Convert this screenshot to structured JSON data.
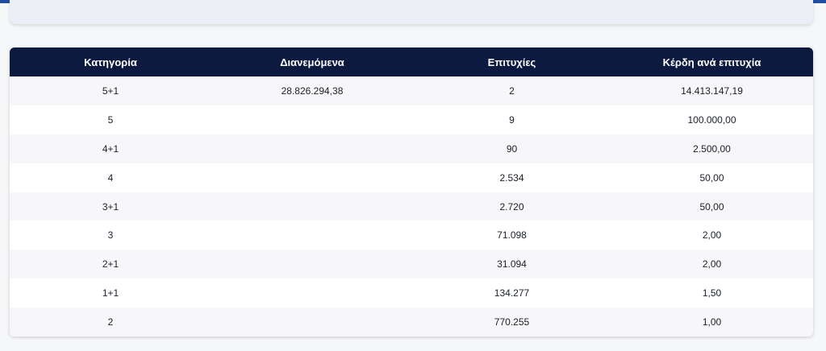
{
  "top_card": {
    "clipped_text": "' '' ' '"
  },
  "table": {
    "headers": [
      "Κατηγορία",
      "Διανεμόμενα",
      "Επιτυχίες",
      "Κέρδη ανά επιτυχία"
    ],
    "rows": [
      [
        "5+1",
        "28.826.294,38",
        "2",
        "14.413.147,19"
      ],
      [
        "5",
        "",
        "9",
        "100.000,00"
      ],
      [
        "4+1",
        "",
        "90",
        "2.500,00"
      ],
      [
        "4",
        "",
        "2.534",
        "50,00"
      ],
      [
        "3+1",
        "",
        "2.720",
        "50,00"
      ],
      [
        "3",
        "",
        "71.098",
        "2,00"
      ],
      [
        "2+1",
        "",
        "31.094",
        "2,00"
      ],
      [
        "1+1",
        "",
        "134.277",
        "1,50"
      ],
      [
        "2",
        "",
        "770.255",
        "1,00"
      ]
    ]
  },
  "colors": {
    "header_bg": "#0c1a40",
    "top_bar": "#1f4fa3"
  }
}
